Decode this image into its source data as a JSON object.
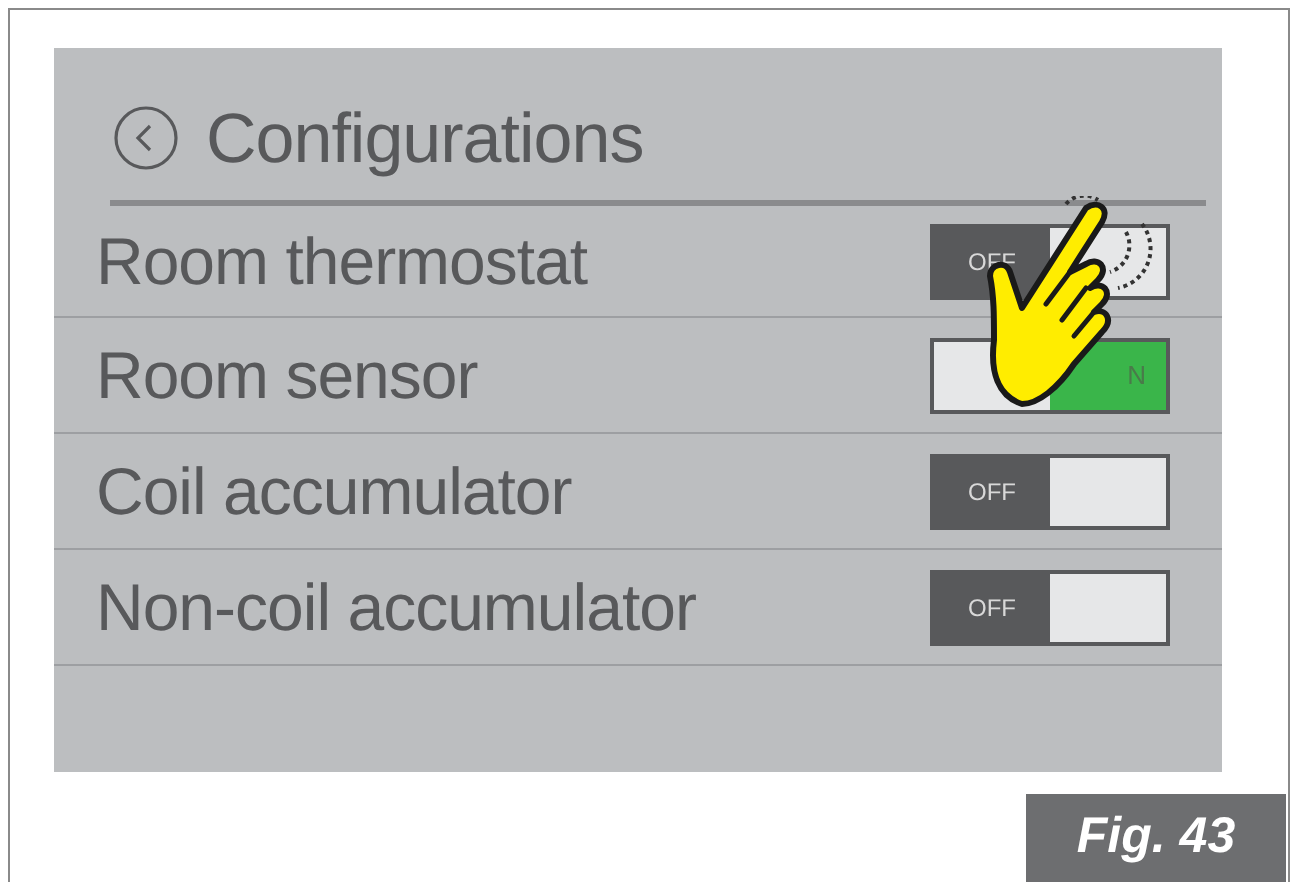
{
  "title": "Configurations",
  "settings": [
    {
      "label": "Room thermostat",
      "on": false,
      "switch_text": "OFF"
    },
    {
      "label": "Room sensor",
      "on": true,
      "switch_text": "N"
    },
    {
      "label": "Coil accumulator",
      "on": false,
      "switch_text": "OFF"
    },
    {
      "label": "Non-coil accumulator",
      "on": false,
      "switch_text": "OFF"
    }
  ],
  "figure_label": "Fig. 43"
}
